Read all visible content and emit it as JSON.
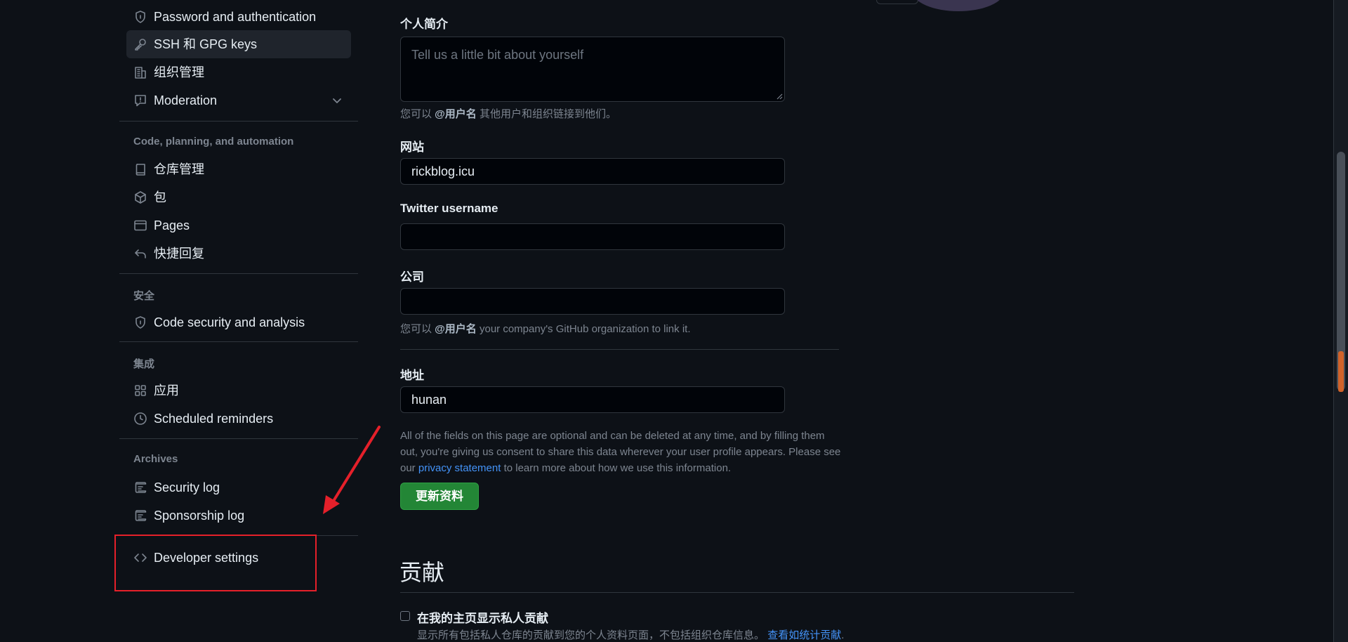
{
  "sidebar": {
    "items_top": [
      {
        "name": "sidebar-item-password",
        "label": "Password and authentication",
        "icon": "shield-lock-icon"
      },
      {
        "name": "sidebar-item-ssh-gpg",
        "label": "SSH 和 GPG keys",
        "icon": "key-icon",
        "active": true
      },
      {
        "name": "sidebar-item-org",
        "label": "组织管理",
        "icon": "organization-icon"
      },
      {
        "name": "sidebar-item-moderation",
        "label": "Moderation",
        "icon": "report-icon"
      }
    ],
    "section_code": "Code, planning, and automation",
    "items_code": [
      {
        "label": "仓库管理"
      },
      {
        "label": "包"
      },
      {
        "label": "Pages"
      },
      {
        "label": "快捷回复"
      }
    ],
    "section_security": "安全",
    "item_code_security": "Code security and analysis",
    "section_integrations": "集成",
    "item_apps": "应用",
    "item_reminders": "Scheduled reminders",
    "section_archives": "Archives",
    "item_security_log": "Security log",
    "item_sponsorship_log": "Sponsorship log",
    "item_developer": "Developer settings"
  },
  "form": {
    "bio_label": "个人简介",
    "bio_placeholder": "Tell us a little bit about yourself",
    "bio_hint_pre": "您可以 ",
    "bio_hint_bold": "@用户名",
    "bio_hint_post": " 其他用户和组织链接到他们。",
    "website_label": "网站",
    "website_value": "rickblog.icu",
    "twitter_label": "Twitter username",
    "twitter_value": "",
    "company_label": "公司",
    "company_value": "",
    "company_hint_pre": "您可以 ",
    "company_hint_bold": "@用户名",
    "company_hint_post": " your company's GitHub organization to link it.",
    "location_label": "地址",
    "location_value": "hunan",
    "disclaimer_pre": "All of the fields on this page are optional and can be deleted at any time, and by filling them out, you're giving us consent to share this data wherever your user profile appears. Please see our ",
    "disclaimer_link": "privacy statement",
    "disclaimer_post": " to learn more about how we use this information.",
    "update_button": "更新资料"
  },
  "contributions": {
    "heading": "贡献",
    "checkbox_label": "在我的主页显示私人贡献",
    "checkbox_desc": "显示所有包括私人仓库的贡献到您的个人资料页面，不包括组织仓库信息。",
    "checkbox_link": "查看如统计贡献",
    "checkbox_end": "."
  },
  "colors": {
    "background": "#0d1117",
    "accent_green": "#238636",
    "link": "#4493f8",
    "annotation_red": "#e5202a"
  }
}
